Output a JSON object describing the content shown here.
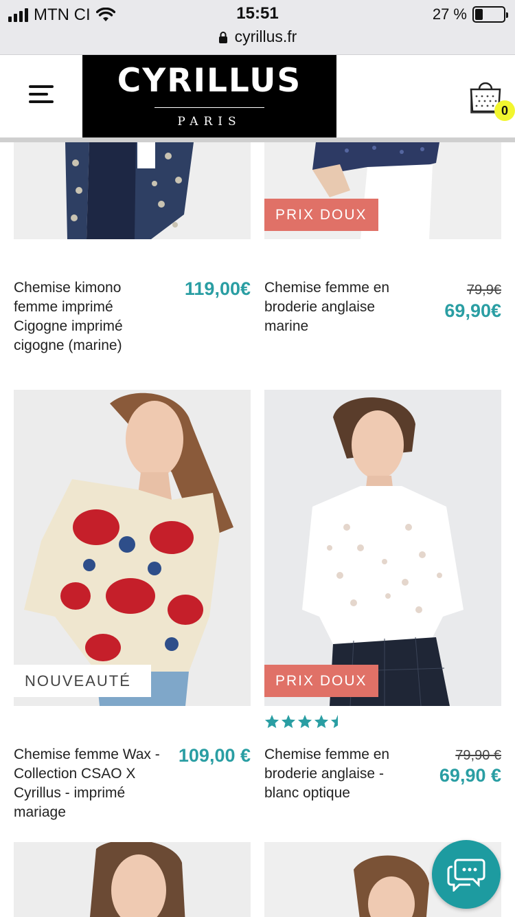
{
  "status_bar": {
    "carrier": "MTN CI",
    "time": "15:51",
    "url": "cyrillus.fr",
    "battery_percent": "27 %",
    "battery_level": 0.27
  },
  "header": {
    "brand": "CYRILLUS",
    "brand_sub": "PARIS",
    "cart_count": "0"
  },
  "products": [
    {
      "title": "Chemise kimono femme imprimé Cigogne imprimé cigogne (marine)",
      "price": "119,00€"
    },
    {
      "title": "Chemise femme en broderie anglaise marine",
      "old_price": "79,9€",
      "price": "69,90€",
      "badge": "PRIX DOUX"
    },
    {
      "title": "Chemise femme Wax - Collection CSAO X Cyrillus - imprimé mariage",
      "price": "109,00 €",
      "badge": "NOUVEAUTÉ"
    },
    {
      "title": "Chemise femme en broderie anglaise - blanc optique",
      "old_price": "79,90 €",
      "price": "69,90 €",
      "badge": "PRIX DOUX",
      "rating": 4.5
    }
  ],
  "colors": {
    "accent_price": "#2a9ea3",
    "badge_prix_doux": "#e07167",
    "cart_badge": "#f2f62f",
    "chat_button": "#1d9ba0"
  },
  "icons": {
    "menu": "hamburger-icon",
    "cart": "shopping-bag-icon",
    "chat": "chat-bubble-icon",
    "lock": "lock-icon",
    "wifi": "wifi-icon",
    "battery": "battery-icon"
  }
}
